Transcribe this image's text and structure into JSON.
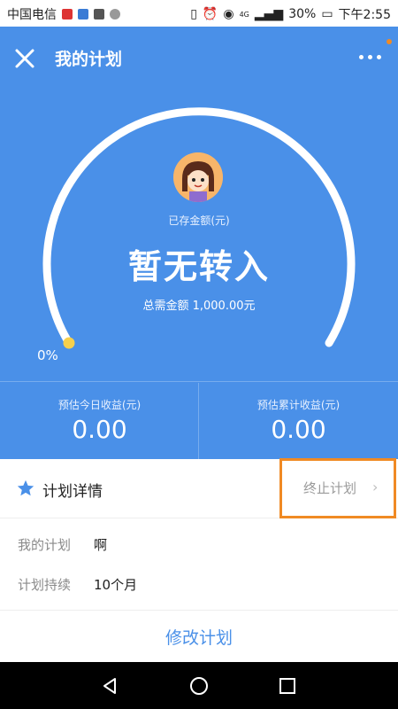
{
  "status_bar": {
    "carrier": "中国电信",
    "battery": "30%",
    "time": "下午2:55",
    "network": "4G"
  },
  "header": {
    "title": "我的计划",
    "close_icon": "close-icon",
    "more_icon": "more-icon"
  },
  "hero": {
    "saved_label": "已存金额(元)",
    "main_text": "暂无转入",
    "total_text": "总需金额 1,000.00元",
    "progress_percent": "0%",
    "progress_value": 0,
    "colors": {
      "background": "#4a90e8",
      "knob": "#f6d04d"
    }
  },
  "stats": [
    {
      "label": "预估今日收益(元)",
      "value": "0.00"
    },
    {
      "label": "预估累计收益(元)",
      "value": "0.00"
    }
  ],
  "details": {
    "title": "计划详情",
    "terminate_label": "终止计划",
    "rows": [
      {
        "label": "我的计划",
        "value": "啊"
      },
      {
        "label": "计划持续",
        "value": "10个月"
      }
    ]
  },
  "footer": {
    "modify_label": "修改计划"
  },
  "navbar": {
    "icons": [
      "back-icon",
      "home-icon",
      "recents-icon"
    ]
  }
}
